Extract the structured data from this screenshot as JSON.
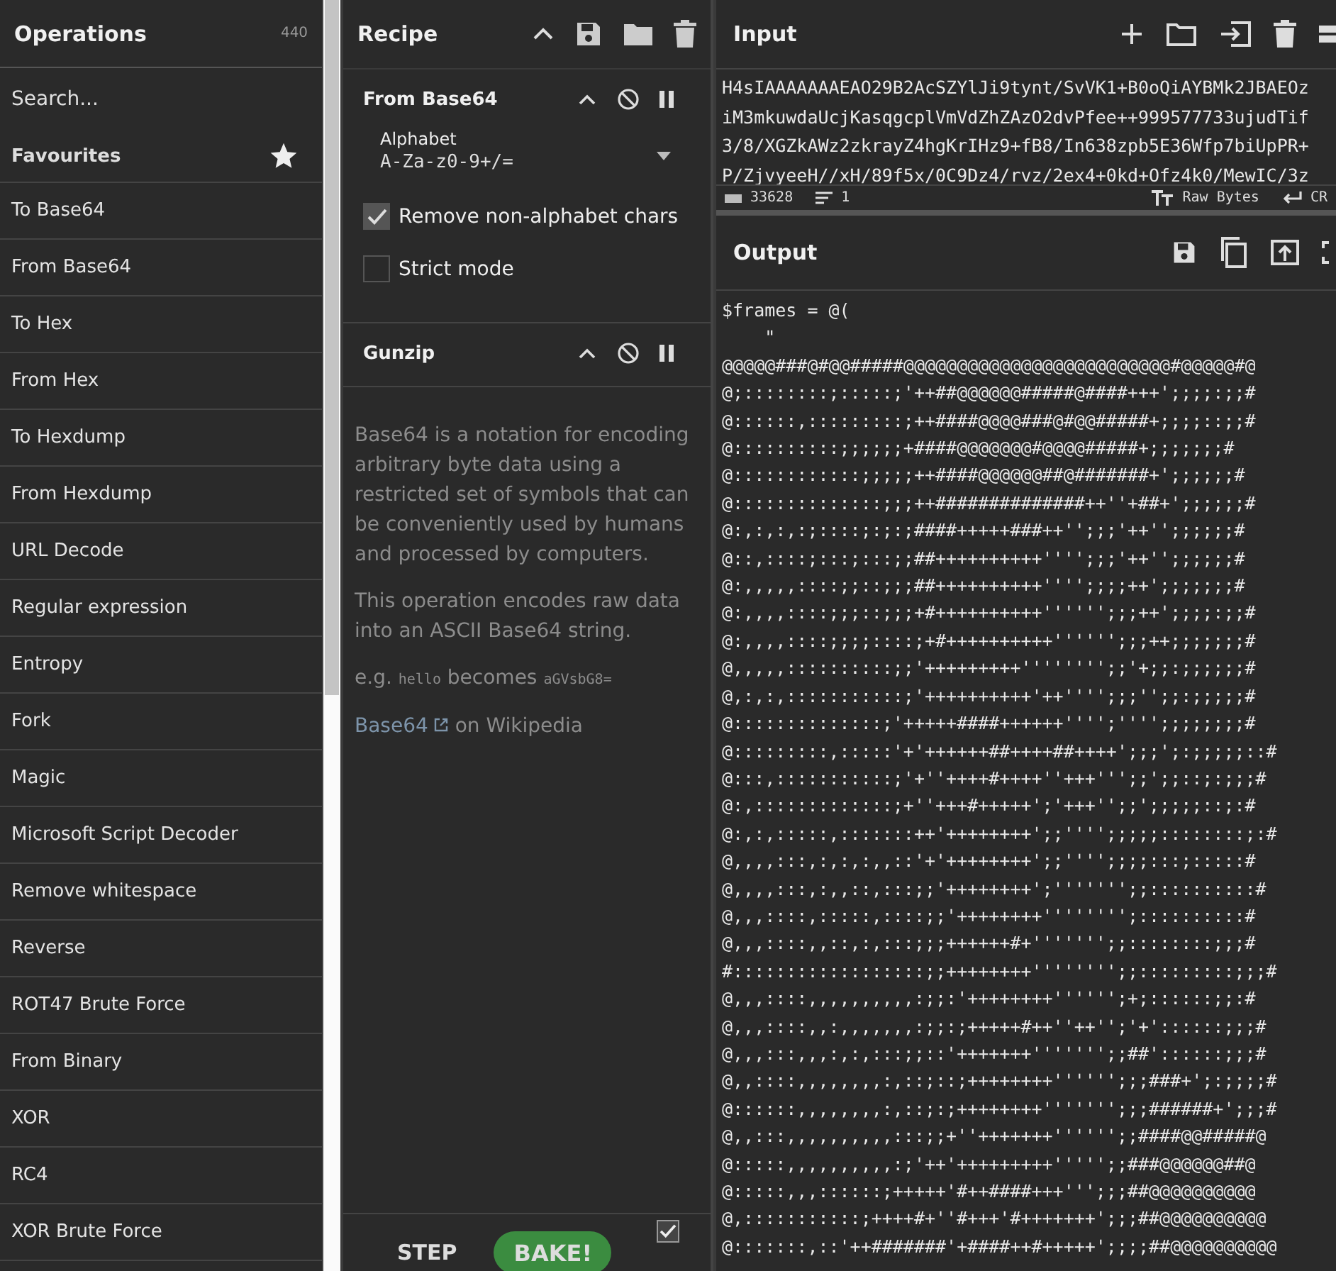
{
  "operations": {
    "title": "Operations",
    "count": "440",
    "search": {
      "placeholder": "Search..."
    },
    "favourites": {
      "label": "Favourites"
    },
    "items": [
      "To Base64",
      "From Base64",
      "To Hex",
      "From Hex",
      "To Hexdump",
      "From Hexdump",
      "URL Decode",
      "Regular expression",
      "Entropy",
      "Fork",
      "Magic",
      "Microsoft Script Decoder",
      "Remove whitespace",
      "Reverse",
      "ROT47 Brute Force",
      "From Binary",
      "XOR",
      "RC4",
      "XOR Brute Force"
    ]
  },
  "recipe": {
    "title": "Recipe",
    "operations": [
      {
        "name": "From Base64",
        "args": [
          {
            "kind": "dropdown",
            "label": "Alphabet",
            "value": "A-Za-z0-9+/="
          },
          {
            "kind": "checkbox",
            "label": "Remove non-alphabet chars",
            "checked": true
          },
          {
            "kind": "checkbox",
            "label": "Strict mode",
            "checked": false
          }
        ]
      },
      {
        "name": "Gunzip"
      }
    ]
  },
  "tooltip": {
    "description": "Base64 is a notation for encoding arbitrary byte data using a restricted set of symbols that can be conveniently used by humans and processed by computers.",
    "detail": "This operation encodes raw data into an ASCII Base64 string.",
    "example": {
      "prefix": "e.g.",
      "input": "hello",
      "middle": "becomes",
      "output": "aGVsbG8="
    },
    "link": {
      "text": "Base64",
      "suffix": "on Wikipedia"
    }
  },
  "controls": {
    "step": "STEP",
    "bake": "BAKE!",
    "auto_bake": {
      "checked": true
    }
  },
  "input": {
    "title": "Input",
    "lines": [
      "H4sIAAAAAAAEAO29B2AcSZYlJi9tynt/SvVK1+B0oQiAYBMk2JBAEOz",
      "iM3mkuwdaUcjKasqgcplVmVdZhZAzO2dvPfee++999577733ujudTif",
      "3/8/XGZkAWz2zkrayZ4hgKrIHz9+fB8/In638zpb5E36Wfp7biUpPR+",
      "P/ZjvyeeH//xH/89f5x/0C9Dz4/rvz/2ex4+0kd+Ofz4k0/MewIC/3z"
    ],
    "status": {
      "length": "33628",
      "lines": "1",
      "encoding": "Raw Bytes",
      "eol": "CR"
    }
  },
  "output": {
    "title": "Output",
    "lines": [
      "$frames = @(",
      "    \"",
      "@@@@@###@#@@#####@@@@@@@@@@@@@@@@@@@@@@@@@#@@@@@#@",
      "@;::::::::;:::::;'++##@@@@@@#####@####+++';;;;:;;#",
      "@::::::,:::::::::;++####@@@@###@#@@#####+;;;;::;;#",
      "@::::::::::;;;;;;+####@@@@@@@#@@@@#####+;;;;;;;#",
      "@::::::::::::;;;;;++####@@@@@@##@#######+';;;;;;#",
      "@::::::::::::::;;;++##############++''+##+';;;;;;#",
      "@:,:,:,:;::::;:;:;####+++++###++'';;;'++'';;;;;;#",
      "@::,::::;:::;:::;;##++++++++++'''';;;'++'';;;;;;#",
      "@:,,,,,::::;;::;;;##++++++++++'''';;;;++';;;;;;;#",
      "@:,,,,::::;;;::;;;+#++++++++++'''''';;;++';;;;:;;#",
      "@:,,,,::::;;;;::::;+#++++++++++'''''';;;++;;;;;;;#",
      "@,,,,,::::::::::;;'+++++++++'''''''';;'+;;:;;;;;;#",
      "@,:,:,:::::::::::;'++++++++++'++'''';;;'';;:;;;;;#",
      "@::::::::::::::;'+++++####++++++'''';'''';;;;;;;;#",
      "@:::::::::,:::::'+'++++++##++++##++++';;;';:;;;;;::#",
      "@:::,:::::::::::;'+''++++#++++''+++''';;';;::;:;;;#",
      "@:,:::::::::::::;+''+++#+++++';'+++'';;';;;;;::;:#",
      "@:,:,:::::,:::::::++'++++++++';;'''';;;;;::::::::;:#",
      "@,,,,:::,:,:,:,,::'+'++++++++';;'''';;;;:::;:::::#",
      "@,,,,:::,:,,::,:::;;'++++++++';''''''';;::::::::::#",
      "@,,,::::,:::::,::::;;'++++++++'''''''';::::::::::#",
      "@,,,::::,,::,:,:::;;;++++++#+''''''';;::::::::;;;#",
      "#::::::::::::::::::;;++++++++'''''''';;:::::::::;;;#",
      "@,,,::::,,,,,,,,,,:;;:'++++++++'''''';+;::::::;;:#",
      "@,,,::::,,:,,,,,,,:;;:;+++++#++''++'';'+'::::::;;;#",
      "@,,,:::,,,:,:,:::;;::'+++++++''''''';;##'::::::;;;#",
      "@,,::::,,,,,,,,:,::;::;++++++++'''''';;;###+';:;;;;#",
      "@::::::,,,,,,,,:,::;:;++++++++''''''';;;######+';;;#",
      "@,,:::,,,,,,,,,,:::;;+''+++++++'''''';;####@@#####@",
      "@:::::,,,,,,,,,,:;'++'+++++++++''''';;###@@@@@@##@",
      "@:::::,,,::::::;+++++'#++####+++''';;;##@@@@@@@@@@",
      "@,:::::::::::;++++#+''#+++'#+++++++';;;##@@@@@@@@@@",
      "@:::::::,::'++#######'+####++#+++++';;;;##@@@@@@@@@@"
    ]
  }
}
